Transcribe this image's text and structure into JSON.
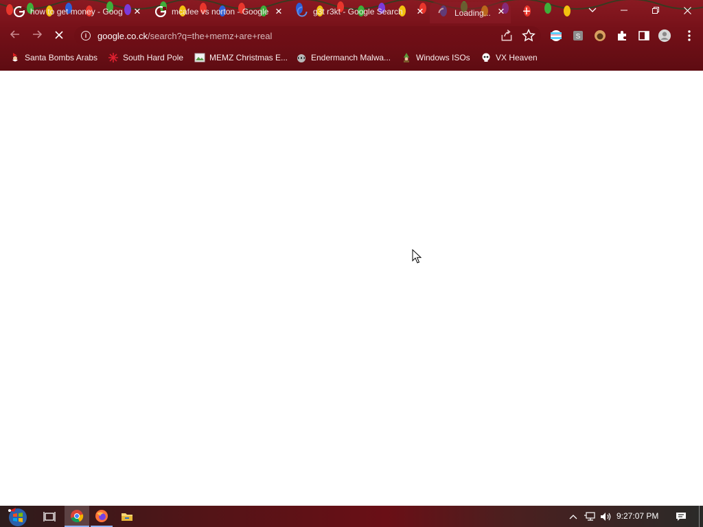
{
  "browser": {
    "tabs": [
      {
        "title": "how to get money - Goog",
        "favicon": "google-g-icon",
        "active": false
      },
      {
        "title": "mcafee vs norton - Google",
        "favicon": "google-g-icon",
        "active": false
      },
      {
        "title": "g3t r3kt - Google Search",
        "favicon": "loading-spinner-icon",
        "active": false
      },
      {
        "title": "Loading...",
        "favicon": "loading-spinner-icon",
        "active": true
      }
    ],
    "url_host": "google.co.ck",
    "url_path": "/search?q=the+memz+are+real",
    "bookmarks": [
      {
        "label": "Santa Bombs Arabs",
        "icon": "santa-icon"
      },
      {
        "label": "South Hard Pole",
        "icon": "snowflake-icon"
      },
      {
        "label": "MEMZ Christmas E...",
        "icon": "image-icon"
      },
      {
        "label": "Endermanch Malwa...",
        "icon": "raccoon-icon"
      },
      {
        "label": "Windows ISOs",
        "icon": "gnome-icon"
      },
      {
        "label": "VX Heaven",
        "icon": "skull-icon"
      }
    ]
  },
  "taskbar": {
    "clock": "9:27:07 PM"
  },
  "colors": {
    "chrome_red": "#741018",
    "page_bg": "#ffffff"
  }
}
